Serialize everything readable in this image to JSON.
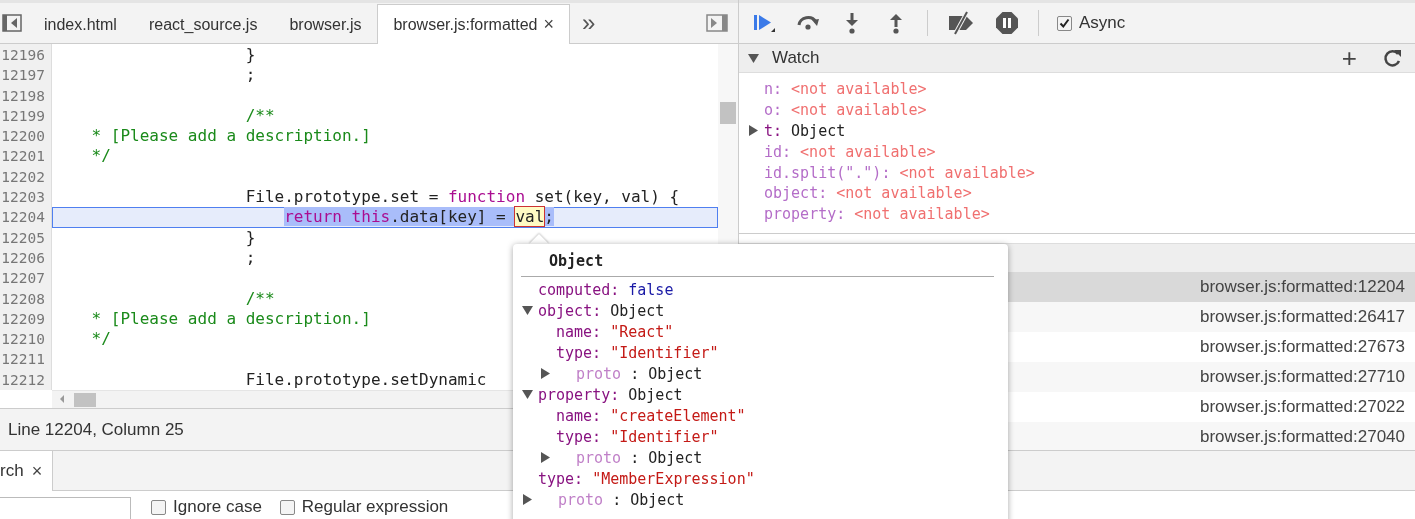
{
  "editor": {
    "tabs": [
      {
        "label": "index.html",
        "selected": false
      },
      {
        "label": "react_source.js",
        "selected": false
      },
      {
        "label": "browser.js",
        "selected": false
      },
      {
        "label": "browser.js:formatted",
        "selected": true,
        "close": "×"
      }
    ],
    "overflow": "»",
    "lines": [
      {
        "number": "12196",
        "current": false,
        "segments": [
          {
            "text": "                    }",
            "kind": "plain",
            "selected": false
          }
        ]
      },
      {
        "number": "12197",
        "current": false,
        "segments": [
          {
            "text": "                    ;",
            "kind": "plain",
            "selected": false
          }
        ]
      },
      {
        "number": "12198",
        "current": false
      },
      {
        "number": "12199",
        "current": false,
        "segments": [
          {
            "text": "                    /**",
            "kind": "comment",
            "selected": false
          }
        ]
      },
      {
        "number": "12200",
        "current": false,
        "segments": [
          {
            "text": "    * [Please add a description.]",
            "kind": "comment",
            "selected": false
          }
        ]
      },
      {
        "number": "12201",
        "current": false,
        "segments": [
          {
            "text": "    */",
            "kind": "comment",
            "selected": false
          }
        ]
      },
      {
        "number": "12202",
        "current": false
      },
      {
        "number": "12203",
        "current": false,
        "segments": [
          {
            "text": "                    File.prototype.set = ",
            "kind": "plain",
            "selected": false
          },
          {
            "text": "function",
            "kind": "keyword",
            "selected": false
          },
          {
            "text": " set(key, val) {",
            "kind": "plain",
            "selected": false
          }
        ]
      },
      {
        "number": "12204",
        "current": true,
        "segments": [
          {
            "text": "                        return this",
            "kind": "keyword",
            "selected": true
          },
          {
            "text": ".data[key] = ",
            "kind": "plain",
            "selected": true
          },
          {
            "text": "val",
            "kind": "hovered",
            "selected": true
          },
          {
            "text": ";",
            "kind": "plain",
            "selected": true
          }
        ]
      },
      {
        "number": "12205",
        "current": false,
        "segments": [
          {
            "text": "                    }",
            "kind": "plain",
            "selected": false
          }
        ]
      },
      {
        "number": "12206",
        "current": false,
        "segments": [
          {
            "text": "                    ;",
            "kind": "plain",
            "selected": false
          }
        ]
      },
      {
        "number": "12207",
        "current": false
      },
      {
        "number": "12208",
        "current": false,
        "segments": [
          {
            "text": "                    /**",
            "kind": "comment",
            "selected": false
          }
        ]
      },
      {
        "number": "12209",
        "current": false,
        "segments": [
          {
            "text": "    * [Please add a description.]",
            "kind": "comment",
            "selected": false
          }
        ]
      },
      {
        "number": "12210",
        "current": false,
        "segments": [
          {
            "text": "    */",
            "kind": "comment",
            "selected": false
          }
        ]
      },
      {
        "number": "12211",
        "current": false
      },
      {
        "number": "12212",
        "current": false,
        "segments": [
          {
            "text": "                    File.prototype.setDynamic",
            "kind": "plain",
            "selected": false
          }
        ]
      }
    ],
    "status": "Line 12204, Column 25"
  },
  "drawer": {
    "tab": {
      "label": "rch",
      "close": "×"
    },
    "options": [
      {
        "label": "Ignore case",
        "checked": false
      },
      {
        "label": "Regular expression",
        "checked": false
      }
    ]
  },
  "debugger": {
    "toolbar": [
      {
        "kind": "resume"
      },
      {
        "kind": "step-over"
      },
      {
        "kind": "step-into"
      },
      {
        "kind": "step-out"
      },
      {
        "kind": "separator"
      },
      {
        "kind": "deactivate"
      },
      {
        "kind": "pause-exceptions"
      },
      {
        "kind": "separator"
      }
    ],
    "async": {
      "label": "Async",
      "checked": true
    },
    "watch": {
      "title": "Watch",
      "expanded": true,
      "add": "+",
      "items": [
        {
          "name": "n:",
          "value": "<not available>",
          "kind": "unavailable"
        },
        {
          "name": "o:",
          "value": "<not available>",
          "kind": "unavailable"
        },
        {
          "name": "t:",
          "value": "Object",
          "kind": "object",
          "expanded": false
        },
        {
          "name": "id:",
          "value": "<not available>",
          "kind": "unavailable"
        },
        {
          "name": "id.split(\".\"):",
          "value": "<not available>",
          "kind": "unavailable"
        },
        {
          "name": "object:",
          "value": "<not available>",
          "kind": "unavailable"
        },
        {
          "name": "property:",
          "value": "<not available>",
          "kind": "unavailable"
        }
      ]
    },
    "call_stack": [
      {
        "location": "browser.js:formatted:12204",
        "selected": true
      },
      {
        "location": "browser.js:formatted:26417",
        "selected": false
      },
      {
        "location": "browser.js:formatted:27673",
        "selected": false
      },
      {
        "location": "browser.js:formatted:27710",
        "selected": false
      },
      {
        "location": "browser.js:formatted:27022",
        "selected": false
      },
      {
        "location": "browser.js:formatted:27040",
        "selected": false
      }
    ]
  },
  "popover": {
    "title": "Object",
    "entries": [
      {
        "key": "computed:",
        "value": "false",
        "kind": "boolean"
      },
      {
        "key": "object:",
        "value": "Object",
        "kind": "object",
        "expanded": true,
        "children": [
          {
            "key": "name:",
            "value": "\"React\"",
            "kind": "string"
          },
          {
            "key": "type:",
            "value": "\"Identifier\"",
            "kind": "string"
          },
          {
            "key": "proto",
            "value": ": Object",
            "kind": "internal",
            "expanded": false
          }
        ]
      },
      {
        "key": "property:",
        "value": "Object",
        "kind": "object",
        "expanded": true,
        "children": [
          {
            "key": "name:",
            "value": "\"createElement\"",
            "kind": "string"
          },
          {
            "key": "type:",
            "value": "\"Identifier\"",
            "kind": "string"
          },
          {
            "key": "proto",
            "value": ": Object",
            "kind": "internal",
            "expanded": false
          }
        ]
      },
      {
        "key": "type:",
        "value": "\"MemberExpression\"",
        "kind": "string"
      },
      {
        "key": "proto",
        "value": ": Object",
        "kind": "internal",
        "expanded": false
      }
    ]
  }
}
